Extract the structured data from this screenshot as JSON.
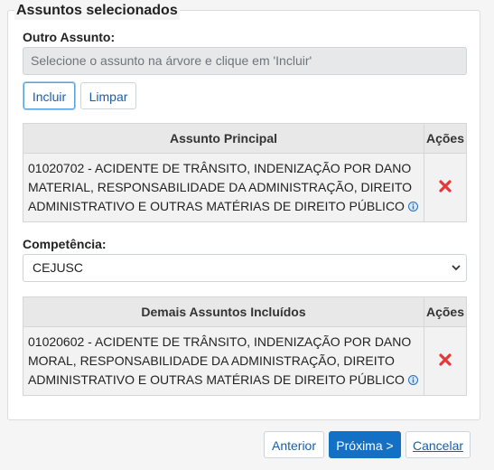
{
  "fieldset": {
    "legend": "Assuntos selecionados"
  },
  "outro_assunto": {
    "label": "Outro Assunto:",
    "placeholder": "Selecione o assunto na árvore e clique em 'Incluir'"
  },
  "buttons": {
    "incluir": "Incluir",
    "limpar": "Limpar"
  },
  "assunto_principal": {
    "header": "Assunto Principal",
    "actions_header": "Ações",
    "rows": [
      {
        "line1": "01020702 - ACIDENTE DE TRÂNSITO, INDENIZAÇÃO POR DANO",
        "line2": "MATERIAL, RESPONSABILIDADE DA ADMINISTRAÇÃO, DIREITO",
        "line3": "ADMINISTRATIVO E OUTRAS MATÉRIAS DE DIREITO PÚBLICO"
      }
    ]
  },
  "competencia": {
    "label": "Competência:",
    "selected": "CEJUSC"
  },
  "demais_assuntos": {
    "header": "Demais Assuntos Incluídos",
    "actions_header": "Ações",
    "rows": [
      {
        "line1": "01020602 - ACIDENTE DE TRÂNSITO, INDENIZAÇÃO POR DANO",
        "line2": "MORAL, RESPONSABILIDADE DA ADMINISTRAÇÃO, DIREITO",
        "line3": "ADMINISTRATIVO E OUTRAS MATÉRIAS DE DIREITO PÚBLICO"
      }
    ]
  },
  "footer": {
    "anterior": "Anterior",
    "proxima": "Próxima >",
    "cancelar": "Cancelar"
  },
  "colors": {
    "primary": "#1470c4",
    "delete": "#e03a3a",
    "info": "#2a6fb5"
  },
  "icons": {
    "delete": "x-mark-icon",
    "info": "info-icon",
    "dropdown": "chevron-down-icon"
  }
}
